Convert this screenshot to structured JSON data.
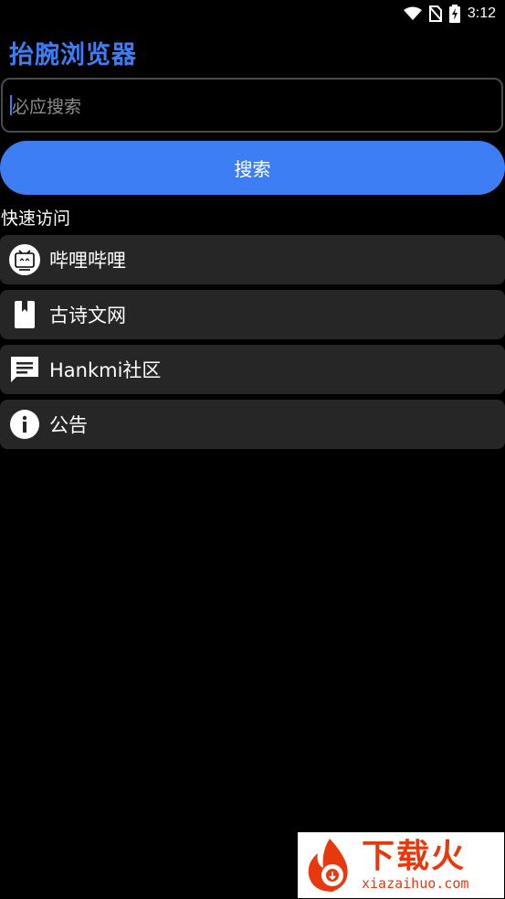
{
  "status_bar": {
    "time": "3:12",
    "icons": [
      "wifi-icon",
      "no-sim-icon",
      "battery-charging-icon"
    ]
  },
  "app": {
    "title": "抬腕浏览器"
  },
  "search": {
    "placeholder": "必应搜索",
    "button_label": "搜索"
  },
  "quick_access": {
    "label": "快速访问",
    "items": [
      {
        "label": "哔哩哔哩",
        "icon": "bilibili-tv-icon"
      },
      {
        "label": "古诗文网",
        "icon": "bookmark-book-icon"
      },
      {
        "label": "Hankmi社区",
        "icon": "chat-message-icon"
      },
      {
        "label": "公告",
        "icon": "info-icon"
      }
    ]
  },
  "watermark": {
    "title": "下载火",
    "url": "xiazaihuo.com",
    "color": "#e8380d"
  },
  "colors": {
    "accent": "#3d7ef5",
    "background": "#000000",
    "item_background": "#262626"
  }
}
